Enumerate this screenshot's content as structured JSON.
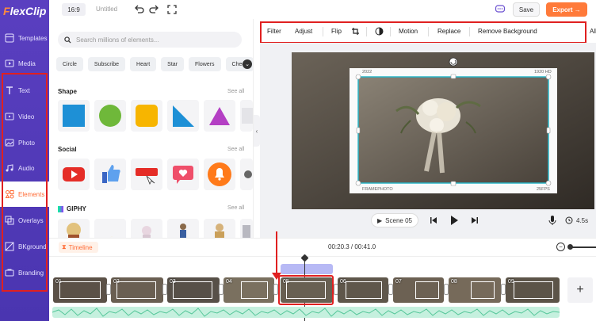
{
  "app": {
    "logo_prefix": "F",
    "logo_rest": "lexClip"
  },
  "header": {
    "ratio": "16:9",
    "title": "Untitled",
    "save": "Save",
    "export": "Export"
  },
  "sidebar": {
    "items": [
      {
        "label": "Templates",
        "icon": "templates-icon"
      },
      {
        "label": "Media",
        "icon": "media-icon"
      },
      {
        "label": "Text",
        "icon": "text-icon"
      },
      {
        "label": "Video",
        "icon": "video-icon"
      },
      {
        "label": "Photo",
        "icon": "photo-icon"
      },
      {
        "label": "Audio",
        "icon": "audio-icon"
      },
      {
        "label": "Elements",
        "icon": "elements-icon",
        "active": true
      },
      {
        "label": "Overlays",
        "icon": "overlays-icon"
      },
      {
        "label": "BKground",
        "icon": "background-icon"
      },
      {
        "label": "Branding",
        "icon": "branding-icon"
      }
    ]
  },
  "panel": {
    "search_placeholder": "Search millions of elements...",
    "chips": [
      "Circle",
      "Subscribe",
      "Heart",
      "Star",
      "Flowers",
      "Check"
    ],
    "sections": [
      {
        "title": "Shape",
        "see_all": "See all"
      },
      {
        "title": "Social",
        "see_all": "See all"
      },
      {
        "title": "GIPHY",
        "see_all": "See all"
      }
    ]
  },
  "toolbar": {
    "items": [
      "Filter",
      "Adjust",
      "Flip",
      "Motion",
      "Replace",
      "Remove Background",
      "All"
    ]
  },
  "canvas": {
    "photo_labels": {
      "top_left": "2022",
      "top_right": "1920 HD",
      "bottom_left": "FRAMEPHOTO",
      "bottom_right": "25FPS"
    }
  },
  "player": {
    "scene_label": "Scene 05",
    "duration": "4.5s"
  },
  "timeline": {
    "label": "Timeline",
    "time": "00:20.3 / 00:41.0",
    "scenes": [
      "01",
      "02",
      "03",
      "04",
      "05",
      "06",
      "07",
      "08",
      "09"
    ],
    "selected_scene": "05",
    "add": "+"
  },
  "colors": {
    "accent": "#ff7a3a",
    "sidebar": "#5a3fc0",
    "annotation": "#e02020",
    "timeline_audio": "#b7b9f5",
    "waveform": "#c5f0de"
  }
}
